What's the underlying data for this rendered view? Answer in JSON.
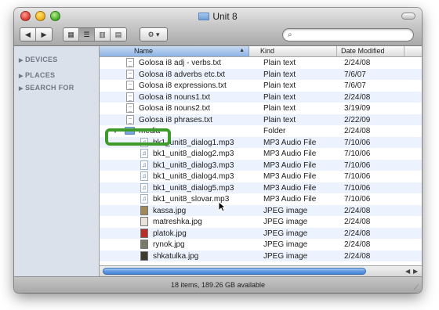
{
  "window": {
    "title": "Unit 8"
  },
  "toolbar": {
    "back_label": "◀",
    "forward_label": "▶",
    "view_modes": [
      "▦",
      "☰",
      "▥",
      "▤"
    ],
    "action_label": "⚙ ▾",
    "search": {
      "value": "",
      "placeholder": ""
    }
  },
  "sidebar": {
    "sections": [
      {
        "label": "DEVICES"
      },
      {
        "label": "PLACES"
      },
      {
        "label": "SEARCH FOR"
      }
    ]
  },
  "columns": {
    "name": "Name",
    "kind": "Kind",
    "date": "Date Modified"
  },
  "files": [
    {
      "name": "Golosa i8 adj - verbs.txt",
      "kind": "Plain text",
      "date": "2/24/08",
      "icon": "text-file-icon"
    },
    {
      "name": "Golosa i8 adverbs etc.txt",
      "kind": "Plain text",
      "date": "7/6/07",
      "icon": "text-file-icon"
    },
    {
      "name": "Golosa i8 expressions.txt",
      "kind": "Plain text",
      "date": "7/6/07",
      "icon": "text-file-icon"
    },
    {
      "name": "Golosa i8 nouns1.txt",
      "kind": "Plain text",
      "date": "2/24/08",
      "icon": "text-file-icon"
    },
    {
      "name": "Golosa i8 nouns2.txt",
      "kind": "Plain text",
      "date": "3/19/09",
      "icon": "text-file-icon"
    },
    {
      "name": "Golosa i8 phrases.txt",
      "kind": "Plain text",
      "date": "2/22/09",
      "icon": "text-file-icon"
    },
    {
      "name": "media",
      "kind": "Folder",
      "date": "2/24/08",
      "icon": "folder-icon",
      "expanded": true
    },
    {
      "name": "bk1_unit8_dialog1.mp3",
      "kind": "MP3 Audio File",
      "date": "7/10/06",
      "icon": "mp3-file-icon"
    },
    {
      "name": "bk1_unit8_dialog2.mp3",
      "kind": "MP3 Audio File",
      "date": "7/10/06",
      "icon": "mp3-file-icon"
    },
    {
      "name": "bk1_unit8_dialog3.mp3",
      "kind": "MP3 Audio File",
      "date": "7/10/06",
      "icon": "mp3-file-icon"
    },
    {
      "name": "bk1_unit8_dialog4.mp3",
      "kind": "MP3 Audio File",
      "date": "7/10/06",
      "icon": "mp3-file-icon"
    },
    {
      "name": "bk1_unit8_dialog5.mp3",
      "kind": "MP3 Audio File",
      "date": "7/10/06",
      "icon": "mp3-file-icon"
    },
    {
      "name": "bk1_unit8_slovar.mp3",
      "kind": "MP3 Audio File",
      "date": "7/10/06",
      "icon": "mp3-file-icon"
    },
    {
      "name": "kassa.jpg",
      "kind": "JPEG image",
      "date": "2/24/08",
      "icon": "jpeg-thumbnail-icon",
      "thumb": "#a08a5a"
    },
    {
      "name": "matreshka.jpg",
      "kind": "JPEG image",
      "date": "2/24/08",
      "icon": "jpeg-thumbnail-icon",
      "thumb": "#e7e2da"
    },
    {
      "name": "platok.jpg",
      "kind": "JPEG image",
      "date": "2/24/08",
      "icon": "jpeg-thumbnail-icon",
      "thumb": "#b5302a"
    },
    {
      "name": "rynok.jpg",
      "kind": "JPEG image",
      "date": "2/24/08",
      "icon": "jpeg-thumbnail-icon",
      "thumb": "#7a7a6a"
    },
    {
      "name": "shkatulka.jpg",
      "kind": "JPEG image",
      "date": "2/24/08",
      "icon": "jpeg-thumbnail-icon",
      "thumb": "#3b3a2c"
    }
  ],
  "status": {
    "text": "18 items, 189.26 GB available"
  },
  "colors": {
    "highlight": "#3f9a2c",
    "selection_column": "#8db3e6",
    "alt_row": "#edf3fe"
  }
}
